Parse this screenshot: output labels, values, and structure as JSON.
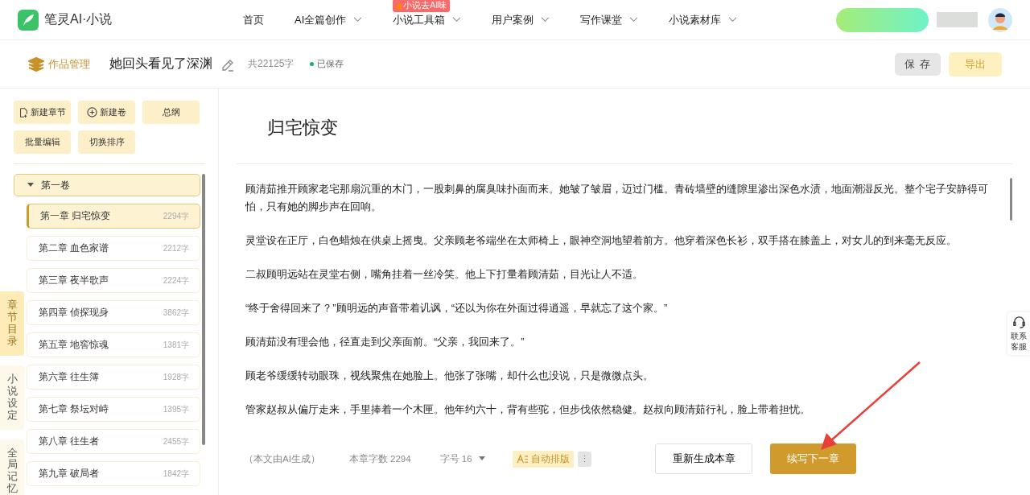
{
  "app": {
    "logo_text": "笔灵AI·小说"
  },
  "nav": [
    {
      "label": "首页",
      "dropdown": false
    },
    {
      "label": "AI全篇创作",
      "dropdown": true
    },
    {
      "label": "小说工具箱",
      "dropdown": true,
      "badge": "小说去AI味"
    },
    {
      "label": "用户案例",
      "dropdown": true
    },
    {
      "label": "写作课堂",
      "dropdown": true
    },
    {
      "label": "小说素材库",
      "dropdown": true
    }
  ],
  "work": {
    "section": "作品管理",
    "title": "她回头看见了深渊",
    "word_count": "共22125字",
    "save_status": "已保存"
  },
  "header_buttons": [
    {
      "label": "保 存",
      "kind": "secondary"
    },
    {
      "label": "导出",
      "kind": "primary"
    }
  ],
  "toolbar_buttons": [
    {
      "label": "新建章节",
      "kind": "chapter"
    },
    {
      "label": "新建卷",
      "kind": "volume"
    },
    {
      "label": "总纲",
      "kind": "plain"
    },
    {
      "label": "批量编辑",
      "kind": "plain"
    },
    {
      "label": "切换排序",
      "kind": "plain"
    }
  ],
  "side_tabs": [
    {
      "label": "章节目录",
      "selected": true
    },
    {
      "label": "小说设定",
      "selected": false
    },
    {
      "label": "全局记忆",
      "selected": false
    }
  ],
  "volume": {
    "label": "第一卷",
    "expanded": true
  },
  "chapters": [
    {
      "title": "第一章 归宅惊变",
      "count": "2294字",
      "selected": true
    },
    {
      "title": "第二章 血色家谱",
      "count": "2212字",
      "selected": false
    },
    {
      "title": "第三章 夜半歌声",
      "count": "2224字",
      "selected": false
    },
    {
      "title": "第四章 侦探现身",
      "count": "3862字",
      "selected": false
    },
    {
      "title": "第五章 地窖惊魂",
      "count": "1381字",
      "selected": false
    },
    {
      "title": "第六章 往生簿",
      "count": "1928字",
      "selected": false
    },
    {
      "title": "第七章 祭坛对峙",
      "count": "1395字",
      "selected": false
    },
    {
      "title": "第八章 往生者",
      "count": "2455字",
      "selected": false
    },
    {
      "title": "第九章 破局者",
      "count": "1842字",
      "selected": false
    }
  ],
  "editor": {
    "chapter_title": "归宅惊变",
    "paragraphs": [
      "顾清茹推开顾家老宅那扇沉重的木门，一股刺鼻的腐臭味扑面而来。她皱了皱眉，迈过门槛。青砖墙壁的缝隙里渗出深色水渍，地面潮湿反光。整个宅子安静得可怕，只有她的脚步声在回响。",
      "灵堂设在正厅，白色蜡烛在供桌上摇曳。父亲顾老爷端坐在太师椅上，眼神空洞地望着前方。他穿着深色长衫，双手搭在膝盖上，对女儿的到来毫无反应。",
      "二叔顾明远站在灵堂右侧，嘴角挂着一丝冷笑。他上下打量着顾清茹，目光让人不适。",
      "“终于舍得回来了？”顾明远的声音带着讥讽，“还以为你在外面过得逍遥，早就忘了这个家。”",
      "顾清茹没有理会他，径直走到父亲面前。“父亲，我回来了。”",
      "顾老爷缓缓转动眼珠，视线聚焦在她脸上。他张了张嘴，却什么也没说，只是微微点头。",
      "管家赵叔从偏厅走来，手里捧着一个木匣。他年约六十，背有些驼，但步伐依然稳健。赵叔向顾清茹行礼，脸上带着担忧。"
    ]
  },
  "footer": {
    "note": "（本文由AI生成）",
    "char_count": "本章字数 2294",
    "font_size": "字号 16",
    "auto_format": "自动排版",
    "more": "⋮",
    "buttons": [
      {
        "label": "重新生成本章",
        "kind": "secondary"
      },
      {
        "label": "续写下一章",
        "kind": "primary"
      }
    ]
  },
  "support": {
    "label": "联系客服"
  }
}
